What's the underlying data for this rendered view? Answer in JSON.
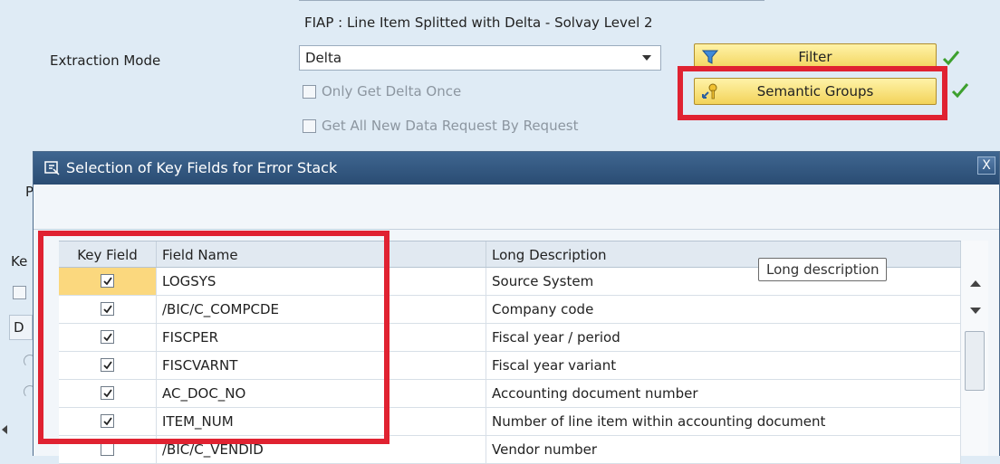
{
  "header": {
    "view_title": "FIAP : Line Item Splitted with Delta - Solvay Level 2",
    "extraction_mode_label": "Extraction Mode",
    "extraction_mode_value": "Delta"
  },
  "options": [
    {
      "label": "Only Get Delta Once",
      "checked": false
    },
    {
      "label": "Get All New Data Request By Request",
      "checked": false
    }
  ],
  "buttons": {
    "filter": "Filter",
    "semantic_groups": "Semantic Groups"
  },
  "left_fragments": {
    "p": "P",
    "ke": "Ke",
    "d": "D"
  },
  "dialog": {
    "title": "Selection of Key Fields for Error Stack",
    "close": "X",
    "columns": [
      "Key Field",
      "Field Name",
      "Long Description"
    ],
    "rows": [
      {
        "key": true,
        "field": "LOGSYS",
        "desc": "Source System"
      },
      {
        "key": true,
        "field": "/BIC/C_COMPCDE",
        "desc": "Company code"
      },
      {
        "key": true,
        "field": "FISCPER",
        "desc": "Fiscal year / period"
      },
      {
        "key": true,
        "field": "FISCVARNT",
        "desc": "Fiscal year variant"
      },
      {
        "key": true,
        "field": "AC_DOC_NO",
        "desc": "Accounting document number"
      },
      {
        "key": true,
        "field": "ITEM_NUM",
        "desc": "Number of line item within accounting document"
      },
      {
        "key": false,
        "field": "/BIC/C_VENDID",
        "desc": "Vendor number"
      }
    ],
    "tooltip": "Long description"
  },
  "colors": {
    "highlight": "#e02231",
    "title_bar": "#2a4c73",
    "selected_cell": "#fbd87e"
  }
}
